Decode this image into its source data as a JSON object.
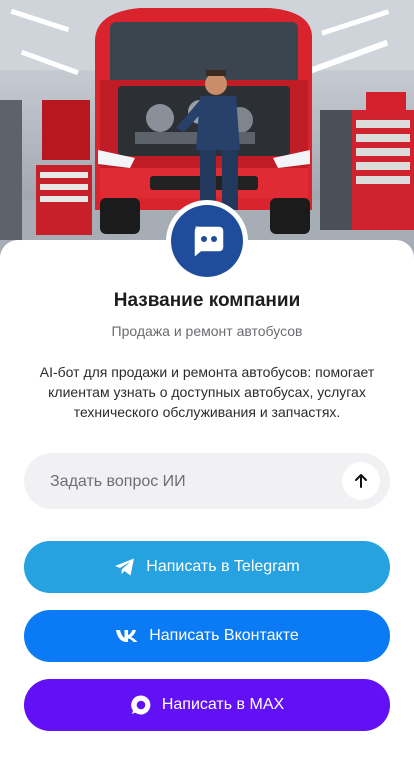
{
  "company": {
    "name": "Название компании",
    "subtitle": "Продажа и ремонт автобусов",
    "description": "AI-бот для продажи и ремонта автобусов: помогает клиентам узнать о доступных автобусах, услугах технического обслуживания и запчастях.",
    "avatar_icon": "chat-bubble-icon",
    "avatar_color": "#1f4d9c"
  },
  "hero": {
    "image_icon": "bus-repair-photo"
  },
  "ask": {
    "placeholder": "Задать вопрос ИИ",
    "send_icon": "arrow-up-icon"
  },
  "buttons": [
    {
      "label": "Написать в Telegram",
      "icon": "telegram-icon",
      "color": "#27a2e0"
    },
    {
      "label": "Написать Вконтакте",
      "icon": "vk-icon",
      "color": "#0a7bf5"
    },
    {
      "label": "Написать в MAX",
      "icon": "max-icon",
      "color": "#6210f5"
    }
  ]
}
